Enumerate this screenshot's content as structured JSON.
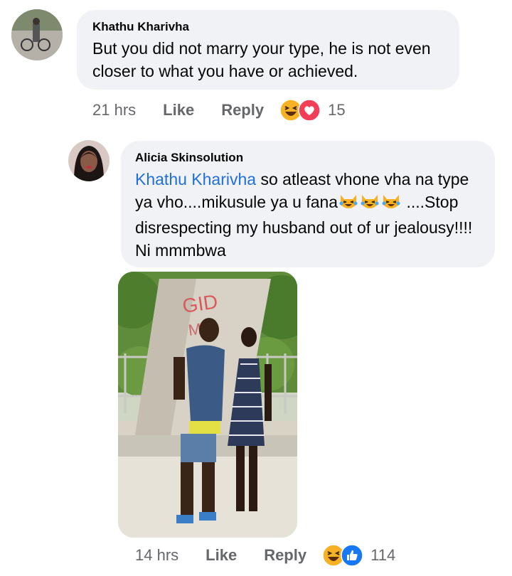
{
  "comments": [
    {
      "author": "Khathu Kharivha",
      "text": "But you did not marry your type, he is not even closer to what you have or achieved.",
      "time": "21 hrs",
      "like_label": "Like",
      "reply_label": "Reply",
      "reactions": [
        "haha",
        "love"
      ],
      "reaction_count": "15"
    },
    {
      "author": "Alicia Skinsolution",
      "mention": "Khathu Kharivha",
      "text_part1": " so atleast vhone vha na type ya vho....mikusule ya u fana",
      "emojis": [
        "crying-laughing-cat",
        "crying-laughing-cat",
        "crying-laughing-cat"
      ],
      "text_part2": " ....Stop disrespecting my husband out of ur jealousy!!!! Ni mmmbwa",
      "time": "14 hrs",
      "like_label": "Like",
      "reply_label": "Reply",
      "reactions": [
        "haha",
        "like"
      ],
      "reaction_count": "114"
    }
  ],
  "colors": {
    "bubble": "#f0f2f5",
    "mention": "#216fdb",
    "meta": "#65676b",
    "like_blue": "#1877f2",
    "love_red": "#f33e58"
  }
}
